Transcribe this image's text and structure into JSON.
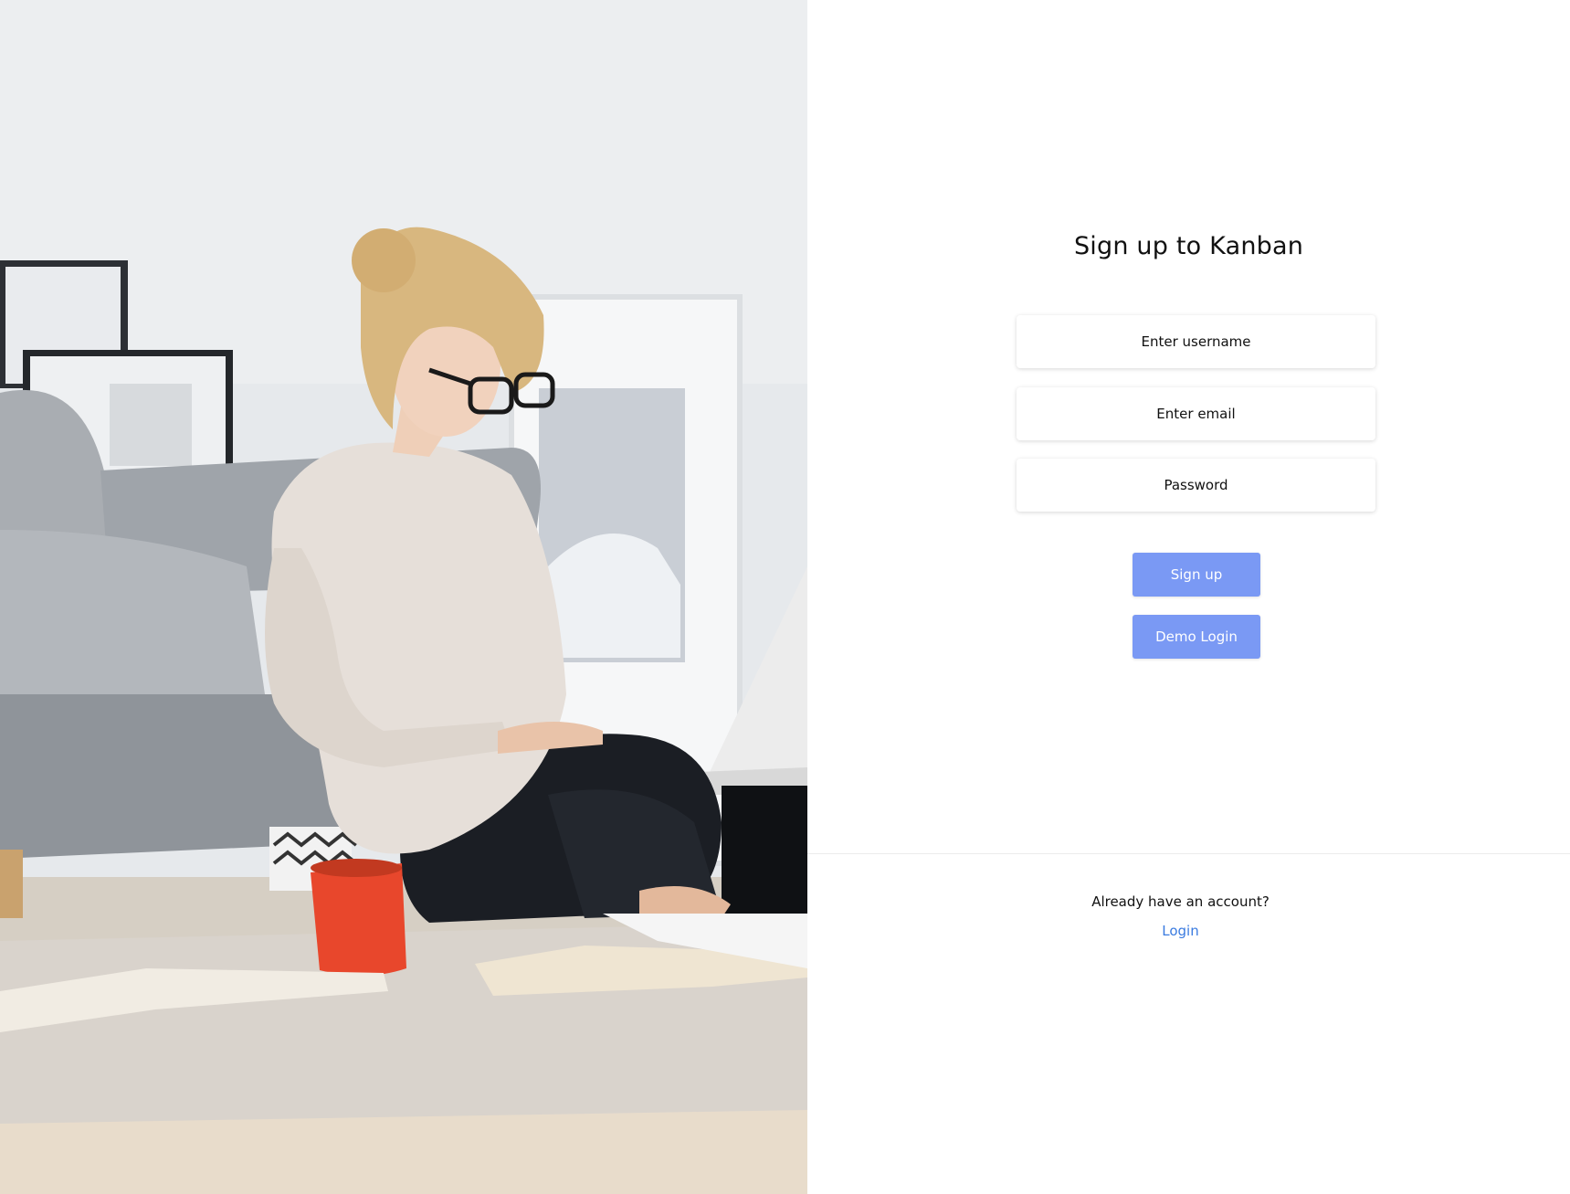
{
  "hero": {
    "image_description_icon": "person-with-laptop-photo"
  },
  "signup": {
    "title": "Sign up to Kanban",
    "username_placeholder": "Enter username",
    "email_placeholder": "Enter email",
    "password_placeholder": "Password",
    "signup_button": "Sign up",
    "demo_button": "Demo Login"
  },
  "footer": {
    "prompt": "Already have an account?",
    "login_link": "Login"
  },
  "colors": {
    "button": "#7a99f4",
    "link": "#3a7be0",
    "panel_bg": "#ffffff"
  }
}
